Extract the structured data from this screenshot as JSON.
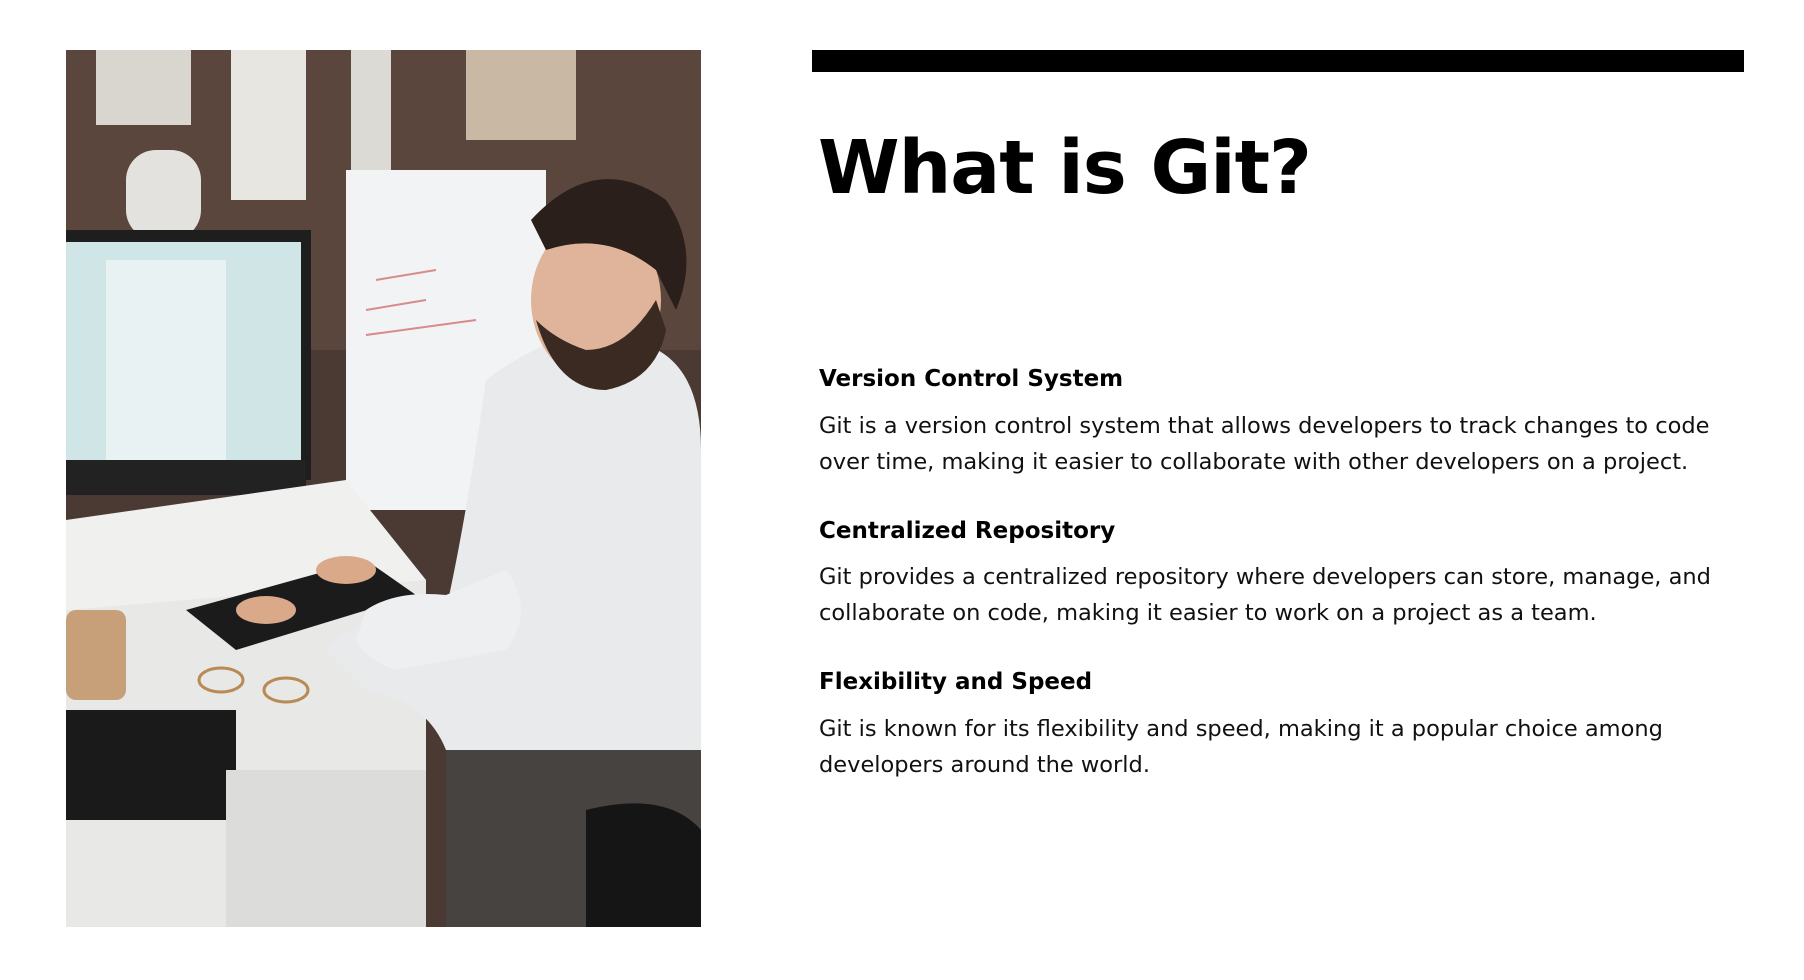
{
  "slide": {
    "title": "What is Git?",
    "sections": [
      {
        "heading": "Version Control System",
        "body": "Git is a version control system that allows developers to track changes to code over time, making it easier to collaborate with other developers on a project."
      },
      {
        "heading": "Centralized Repository",
        "body": "Git provides a centralized repository where developers can store, manage, and collaborate on code, making it easier to work on a project as a team."
      },
      {
        "heading": "Flexibility and Speed",
        "body": "Git is known for its flexibility and speed, making it a popular choice among developers around the world."
      }
    ]
  },
  "colors": {
    "text": "#000000",
    "accent_bar": "#000000",
    "background": "#ffffff"
  },
  "image": {
    "icon": "developer-photo"
  }
}
